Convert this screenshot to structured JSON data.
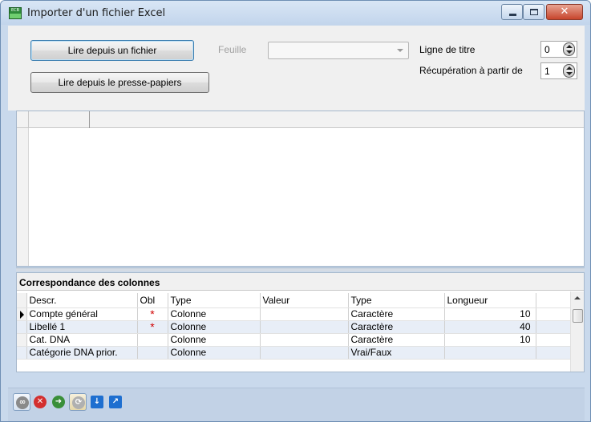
{
  "window": {
    "title": "Importer d'un fichier Excel",
    "app_icon_top": "ECB",
    "close_glyph": "✕"
  },
  "import": {
    "read_file_label": "Lire depuis un fichier",
    "read_clipboard_label": "Lire depuis le presse-papiers",
    "sheet_label": "Feuille",
    "sheet_value": "",
    "title_row_label": "Ligne de titre",
    "title_row_value": "0",
    "start_row_label": "Récupération à partir de",
    "start_row_value": "1"
  },
  "mapping": {
    "title": "Correspondance des colonnes",
    "columns": [
      "Descr.",
      "Obl",
      "Type",
      "Valeur",
      "Type",
      "Longueur"
    ],
    "rows": [
      {
        "descr": "Compte général",
        "obl": "*",
        "type": "Colonne",
        "valeur": "",
        "type2": "Caractère",
        "longueur": "10",
        "current": true
      },
      {
        "descr": "Libellé 1",
        "obl": "*",
        "type": "Colonne",
        "valeur": "",
        "type2": "Caractère",
        "longueur": "40",
        "current": false
      },
      {
        "descr": "Cat. DNA",
        "obl": "",
        "type": "Colonne",
        "valeur": "",
        "type2": "Caractère",
        "longueur": "10",
        "current": false
      },
      {
        "descr": "Catégorie DNA prior.",
        "obl": "",
        "type": "Colonne",
        "valeur": "",
        "type2": "Vrai/Faux",
        "longueur": "",
        "current": false
      }
    ]
  },
  "toolbar": {
    "buttons": [
      {
        "icon": "link-icon",
        "color": "#8a8a8a",
        "glyph": "∞"
      },
      {
        "icon": "cancel-icon",
        "color": "#d32f2f",
        "glyph": "✕"
      },
      {
        "icon": "import-icon",
        "color": "#3a8f3a",
        "glyph": "➜"
      },
      {
        "icon": "refresh-icon",
        "color": "#b0b0b0",
        "glyph": "⟳"
      },
      {
        "icon": "arrow-down-icon",
        "color": "#1e6fd0",
        "glyph": "↓"
      },
      {
        "icon": "arrow-export-icon",
        "color": "#1e6fd0",
        "glyph": "↗"
      }
    ]
  },
  "colors": {
    "accent": "#3c7fb1",
    "required_marker": "#d00000"
  }
}
